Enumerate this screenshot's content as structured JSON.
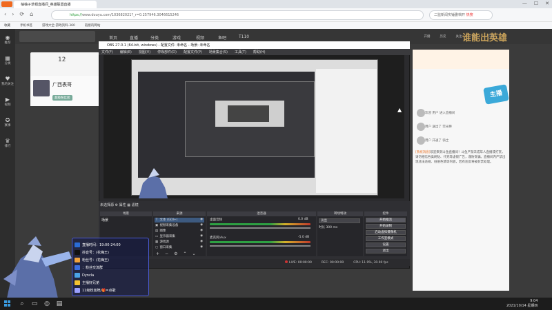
{
  "browser": {
    "tab_title": "柚柚子草帽直播间_英雄联盟直播",
    "url_prefix": "https://",
    "url_host": "www.douyu.com",
    "url_path": "/103682021?_r=0.257946.3046615246",
    "search_text": "二监新闻实锤删档开",
    "search_hot": "热搜",
    "win_controls": [
      "—",
      "☐",
      "✕"
    ],
    "nav_icons": [
      "‹",
      "›",
      "⟳",
      "⌂"
    ],
    "bookmarks": [
      "收藏",
      "手机书签",
      "游戏大全-游戏资料-360",
      "链接的网站"
    ]
  },
  "left_sidebar": {
    "items": [
      {
        "icon": "◉",
        "label": "推荐"
      },
      {
        "icon": "▦",
        "label": "分类"
      },
      {
        "icon": "♥",
        "label": "我的关注"
      },
      {
        "icon": "▶",
        "label": "视频"
      },
      {
        "icon": "✪",
        "label": "赛事"
      },
      {
        "icon": "♛",
        "label": "排行"
      }
    ]
  },
  "site": {
    "nav_items": [
      "首页",
      "直播",
      "分类",
      "游戏",
      "视频",
      "鱼吧",
      "T110"
    ],
    "header_right": [
      "开播",
      "历史",
      "关注",
      "消息",
      "下载"
    ],
    "banner_text": "谁能出英雄",
    "room_id": "12",
    "room_title": "广西表哥",
    "badge_text": "超级粉丝团",
    "ad_text": "主播",
    "chat_notice_label": "[系统消息]",
    "chat_notice": "欢迎来到斗鱼直播间！斗鱼严禁未成年人直播或打赏，请勿相信各类刷钻、代充等虚假广告，谨防受骗。直播间内严禁出现违法违规、低俗色情等内容，若有违反将被封禁处理。",
    "chat_lines": [
      "欢迎 用户 进入直播间",
      "用户 送出了 荧光棒",
      "用户 开通了 骑士"
    ]
  },
  "obs": {
    "title": "OBS 27.0.1 (64-bit, windows) - 配置文件: 未命名 - 场景: 未命名",
    "menu": [
      "文件(F)",
      "编辑(E)",
      "视图(V)",
      "停靠部件(D)",
      "配置文件(P)",
      "场景集合(S)",
      "工具(T)",
      "帮助(H)"
    ],
    "scene_toolbar": "未选择源    ⚙ 属性    ▦ 滤镜",
    "docks": [
      "场景",
      "来源",
      "混音器",
      "转场特效",
      "控件"
    ],
    "scene_item": "场景",
    "sources": [
      {
        "icon": "T",
        "name": "文本 (GDI+)"
      },
      {
        "icon": "▣",
        "name": "视频采集设备"
      },
      {
        "icon": "▤",
        "name": "图像"
      },
      {
        "icon": "▭",
        "name": "显示器采集"
      },
      {
        "icon": "▦",
        "name": "游戏源"
      },
      {
        "icon": "▢",
        "name": "窗口采集"
      }
    ],
    "mixer": [
      {
        "name": "桌面音频",
        "level": "0.0 dB"
      },
      {
        "name": "麦克风/Aux",
        "level": "-5.0 dB"
      }
    ],
    "transition": "淡出",
    "transition_duration": "时长  300 ms",
    "controls": [
      "开始推流",
      "开始录制",
      "启动虚拟摄像机",
      "工作室模式",
      "设置",
      "退出"
    ],
    "status": [
      "LIVE: 00:00:00",
      "REC: 00:00:00",
      "CPU: 11.9%, 30.00 fps"
    ]
  },
  "overlay": {
    "lines": [
      {
        "icon_color": "#2a6cd6",
        "text": "直播时间：19:00-24:00"
      },
      {
        "icon_color": "#111111",
        "text": "抖音号：(花嗨王)"
      },
      {
        "icon_color": "#f2a33a",
        "text": "粉丝号：(花嗨王)"
      },
      {
        "icon_color": "#3b6fe0",
        "text": "：粉丝交流群"
      },
      {
        "icon_color": "#4aa3e8",
        "text": "Dyncla"
      },
      {
        "icon_color": "#f2c230",
        "text": "主播好兄弟"
      },
      {
        "icon_color": "#9aa0ff",
        "text": "11级粉丝牌/🎁=点歌"
      }
    ]
  },
  "taskbar": {
    "time": "9:04",
    "date": "2021/10/14 星期四"
  },
  "colors": {
    "accent": "#f06a20",
    "site_bg": "#3b3b3b",
    "obs_bg": "#2b2b2e",
    "overlay_border": "#4b5bd6"
  }
}
